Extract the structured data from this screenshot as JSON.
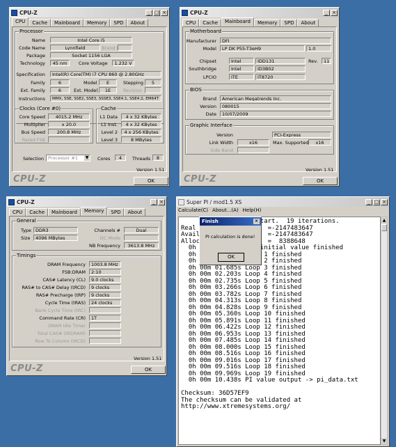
{
  "cpuz_cpu": {
    "title": "CPU-Z",
    "tabs": [
      "CPU",
      "Cache",
      "Mainboard",
      "Memory",
      "SPD",
      "About"
    ],
    "processor_group": "Processor",
    "name_label": "Name",
    "name": "Intel Core i5",
    "codename_label": "Code Name",
    "codename": "Lynnfield",
    "brandid": "Brand ID",
    "package_label": "Package",
    "package": "Socket 1156 LGA",
    "technology_label": "Technology",
    "technology": "45 nm",
    "corevoltage_label": "Core Voltage",
    "corevoltage": "1.232 V",
    "spec_label": "Specification",
    "spec": "Intel(R) Core(TM) i7 CPU        860  @ 2.80GHz",
    "family_label": "Family",
    "family": "6",
    "model_label": "Model",
    "model": "E",
    "stepping_label": "Stepping",
    "stepping": "5",
    "extfamily_label": "Ext. Family",
    "extfamily": "6",
    "extmodel_label": "Ext. Model",
    "extmodel": "1E",
    "revision_label": "Revision",
    "revision": "",
    "instructions_label": "Instructions",
    "instructions": "MMX, SSE, SSE2, SSE3, SSSE3, SSE4.1, SSE4.2, EM64T",
    "clocks_group": "Clocks (Core #0)",
    "corespeed_label": "Core Speed",
    "corespeed": "4015.2 MHz",
    "multiplier_label": "Multiplier",
    "multiplier": "x 20.0",
    "busspeed_label": "Bus Speed",
    "busspeed": "200.8 MHz",
    "ratedfsb_label": "Rated FSB",
    "ratedfsb": "",
    "cache_group": "Cache",
    "l1data_label": "L1 Data",
    "l1data": "4 x 32 KBytes",
    "l1inst_label": "L1 Inst.",
    "l1inst": "4 x 32 KBytes",
    "level2_label": "Level 2",
    "level2": "4 x 256 KBytes",
    "level3_label": "Level 3",
    "level3": "8 MBytes",
    "selection_label": "Selection",
    "selection": "Processor #1",
    "cores_label": "Cores",
    "cores": "4",
    "threads_label": "Threads",
    "threads": "8",
    "version": "Version 1.51",
    "ok": "OK",
    "brand": "CPU-Z"
  },
  "cpuz_mb": {
    "title": "CPU-Z",
    "tabs": [
      "CPU",
      "Cache",
      "Mainboard",
      "Memory",
      "SPD",
      "About"
    ],
    "mb_group": "Motherboard",
    "manufacturer_label": "Manufacturer",
    "manufacturer": "DFI",
    "model_label": "Model",
    "model": "LP DK P55-T3eH9",
    "model_rev": "1.0",
    "chipset_label": "Chipset",
    "chipset_v": "Intel",
    "chipset_m": "IDD131",
    "rev_label": "Rev.",
    "rev": "11",
    "southbridge_label": "Southbridge",
    "sb_v": "Intel",
    "sb_m": "ID3B02",
    "lpcio_label": "LPCIO",
    "lpcio_v": "ITE",
    "lpcio_m": "IT8720",
    "bios_group": "BIOS",
    "brand_label": "Brand",
    "brand": "American Megatrends Inc.",
    "version_label": "Version",
    "version": "080015",
    "date_label": "Date",
    "date": "10/07/2009",
    "gfx_group": "Graphic Interface",
    "gversion_label": "Version",
    "gversion": "PCI-Express",
    "linkwidth_label": "Link Width",
    "linkwidth": "x16",
    "maxsup_label": "Max. Supported",
    "maxsup": "x16",
    "sideband_label": "Side Band",
    "ver": "Version 1.51",
    "ok": "OK",
    "logo": "CPU-Z"
  },
  "cpuz_mem": {
    "title": "CPU-Z",
    "tabs": [
      "CPU",
      "Cache",
      "Mainboard",
      "Memory",
      "SPD",
      "About"
    ],
    "general_group": "General",
    "type_label": "Type",
    "type": "DDR3",
    "size_label": "Size",
    "size": "4096 MBytes",
    "channels_label": "Channels #",
    "channels": "Dual",
    "dcmode_label": "DC Mode",
    "nbfreq_label": "NB Frequency",
    "nbfreq": "3613.8 MHz",
    "timings_group": "Timings",
    "rows": [
      {
        "label": "DRAM Frequency",
        "value": "1003.8 MHz",
        "dim": false
      },
      {
        "label": "FSB:DRAM",
        "value": "2:10",
        "dim": false
      },
      {
        "label": "CAS# Latency (CL)",
        "value": "9.0 clocks",
        "dim": false
      },
      {
        "label": "RAS# to CAS# Delay (tRCD)",
        "value": "9 clocks",
        "dim": false
      },
      {
        "label": "RAS# Precharge (tRP)",
        "value": "9 clocks",
        "dim": false
      },
      {
        "label": "Cycle Time (tRAS)",
        "value": "24 clocks",
        "dim": false
      },
      {
        "label": "Bank Cycle Time (tRC)",
        "value": "",
        "dim": true
      },
      {
        "label": "Command Rate (CR)",
        "value": "1T",
        "dim": false
      },
      {
        "label": "DRAM Idle Timer",
        "value": "",
        "dim": true
      },
      {
        "label": "Total CAS# (tRDRAM)",
        "value": "",
        "dim": true
      },
      {
        "label": "Row To Column (tRCD)",
        "value": "",
        "dim": true
      }
    ],
    "ver": "Version 1.51",
    "ok": "OK",
    "logo": "CPU-Z"
  },
  "superpi": {
    "title": "Super PI / mod1.5 XS",
    "menu": [
      "Calculate(C)",
      "About...(A)",
      "Help(H)"
    ],
    "lines": [
      "     1M Calculation Start.  19 iterations.",
      "Real memory            =-2147483647",
      "Available real memory  =-2147483647",
      "Allocated memory       =  8388648",
      "  0h 00m 00.234s The initial value finished",
      "  0h 00m 00.874s Loop 1 finished",
      "  0h 00m 01.185s Loop 2 finished",
      "  0h 00m 01.685s Loop 3 finished",
      "  0h 00m 02.203s Loop 4 finished",
      "  0h 00m 02.735s Loop 5 finished",
      "  0h 00m 03.266s Loop 6 finished",
      "  0h 00m 03.782s Loop 7 finished",
      "  0h 00m 04.313s Loop 8 finished",
      "  0h 00m 04.828s Loop 9 finished",
      "  0h 00m 05.360s Loop 10 finished",
      "  0h 00m 05.891s Loop 11 finished",
      "  0h 00m 06.422s Loop 12 finished",
      "  0h 00m 06.953s Loop 13 finished",
      "  0h 00m 07.485s Loop 14 finished",
      "  0h 00m 08.000s Loop 15 finished",
      "  0h 00m 08.516s Loop 16 finished",
      "  0h 00m 09.016s Loop 17 finished",
      "  0h 00m 09.516s Loop 18 finished",
      "  0h 00m 09.969s Loop 19 finished",
      "  0h 00m 10.438s PI value output -> pi_data.txt",
      "",
      "Checksum: 36D57EF9",
      "The checksum can be validated at",
      "http://www.xtremesystems.org/"
    ]
  },
  "finish": {
    "title": "Finish",
    "message": "PI calculation is done!",
    "ok": "OK"
  }
}
